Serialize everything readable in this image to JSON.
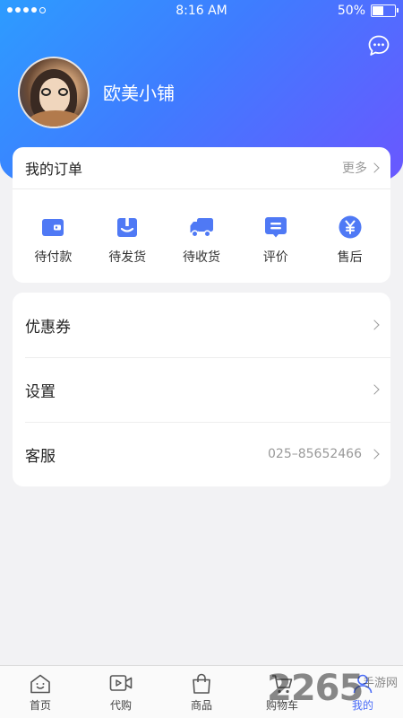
{
  "status_bar": {
    "time": "8:16 AM",
    "battery_percent_text": "50%",
    "battery_level": 0.5,
    "signal_filled": 4,
    "signal_total": 5
  },
  "header": {
    "shop_name": "欧美小铺",
    "message_icon": "chat-bubble-icon",
    "gradient_colors": [
      "#2d9cff",
      "#6a57ff"
    ]
  },
  "orders": {
    "title": "我的订单",
    "more_label": "更多",
    "items": [
      {
        "label": "待付款",
        "icon": "wallet-icon"
      },
      {
        "label": "待发货",
        "icon": "gift-box-icon"
      },
      {
        "label": "待收货",
        "icon": "truck-icon"
      },
      {
        "label": "评价",
        "icon": "comment-icon"
      },
      {
        "label": "售后",
        "icon": "yuan-coin-icon"
      }
    ]
  },
  "menu": {
    "items": [
      {
        "label": "优惠券",
        "value": ""
      },
      {
        "label": "设置",
        "value": ""
      },
      {
        "label": "客服",
        "value": "025–85652466"
      }
    ]
  },
  "bottom_nav": {
    "items": [
      {
        "label": "首页",
        "icon": "home-icon",
        "active": false
      },
      {
        "label": "代购",
        "icon": "video-icon",
        "active": false
      },
      {
        "label": "商品",
        "icon": "shopping-bag-icon",
        "active": false
      },
      {
        "label": "购物车",
        "icon": "cart-icon",
        "active": false
      },
      {
        "label": "我的",
        "icon": "user-icon",
        "active": true
      }
    ],
    "active_color": "#4a6cf7"
  },
  "watermark": {
    "number": "2265",
    "text": "手游网"
  },
  "colors": {
    "accent_blue": "#4a6cf7",
    "icon_blue": "#4f79f5"
  }
}
